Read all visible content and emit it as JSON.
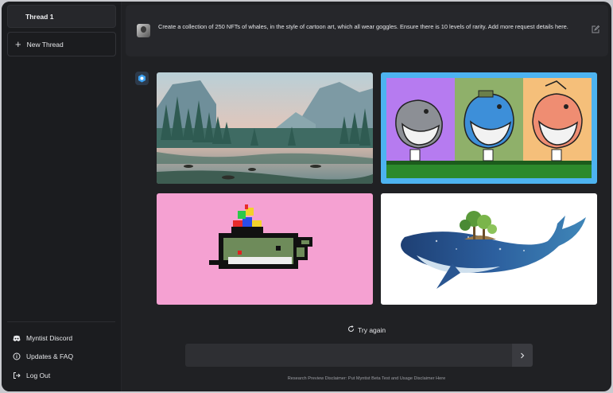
{
  "sidebar": {
    "current_thread": "Thread 1",
    "new_thread_label": "New Thread",
    "links": [
      {
        "label": "Myntist Discord",
        "icon": "discord-icon"
      },
      {
        "label": "Updates & FAQ",
        "icon": "info-icon"
      },
      {
        "label": "Log Out",
        "icon": "logout-icon"
      }
    ]
  },
  "prompt": {
    "text": "Create a collection of 250 NFTs of whales, in the style of cartoon art, which all wear goggles. Ensure there is 10 levels of rarity. Add more request details here."
  },
  "results": {
    "images": [
      {
        "name": "mountain-lake-landscape",
        "selected": false
      },
      {
        "name": "three-cartoon-whales-with-goggles",
        "selected": true
      },
      {
        "name": "pixel-art-whale-propeller-hat",
        "selected": false
      },
      {
        "name": "watercolor-whale-with-island",
        "selected": false
      }
    ],
    "try_again_label": "Try again"
  },
  "composer": {
    "value": "",
    "placeholder": ""
  },
  "footer": {
    "disclaimer": "Research Preview Disclaimer: Put Myntist Beta Test and Usage Disclaimer Here"
  },
  "colors": {
    "background": "#202124",
    "sidebar": "#1b1c1f",
    "card": "#26272b",
    "selection": "#4db3f0",
    "pink_tile": "#f5a1d2"
  }
}
